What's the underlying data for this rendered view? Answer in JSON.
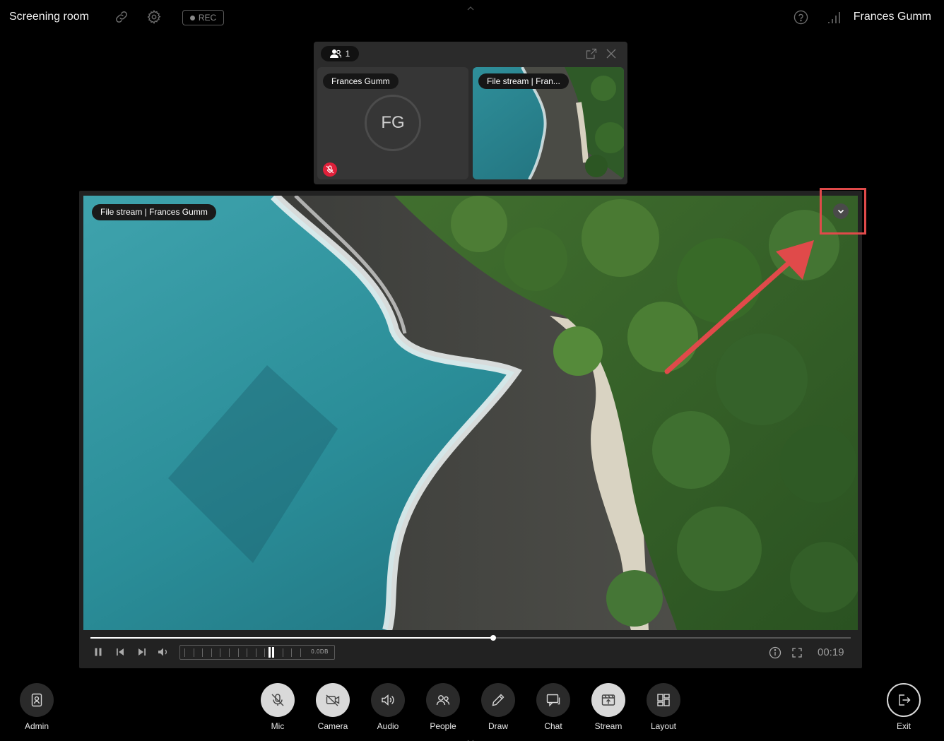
{
  "header": {
    "room_title": "Screening room",
    "rec_label": "REC",
    "user_name": "Frances Gumm"
  },
  "participants": {
    "count": "1",
    "person_tile": {
      "name": "Frances Gumm",
      "initials": "FG",
      "mic": "muted"
    },
    "stream_tile": {
      "label": "File stream | Fran..."
    }
  },
  "stage": {
    "stream_label": "File stream | Frances Gumm"
  },
  "player": {
    "progress": 0.53,
    "volume_readout": "0.0DB",
    "volume_level": 0.77,
    "time": "00:19"
  },
  "toolbar": {
    "admin": "Admin",
    "mic": "Mic",
    "camera": "Camera",
    "audio": "Audio",
    "people": "People",
    "draw": "Draw",
    "chat": "Chat",
    "stream": "Stream",
    "layout": "Layout",
    "exit": "Exit"
  },
  "colors": {
    "background": "#000000",
    "muted_badge": "#e0203a",
    "annotation": "#e04a4a",
    "active_button": "#d9d9d9"
  },
  "icons": [
    "link-icon",
    "gear-icon",
    "help-icon",
    "signal-icon",
    "people-icon",
    "pop-out-icon",
    "close-icon",
    "mic-off-icon",
    "chevron-down-icon",
    "pause-icon",
    "skip-back-icon",
    "skip-forward-icon",
    "volume-icon",
    "info-icon",
    "fullscreen-icon"
  ]
}
